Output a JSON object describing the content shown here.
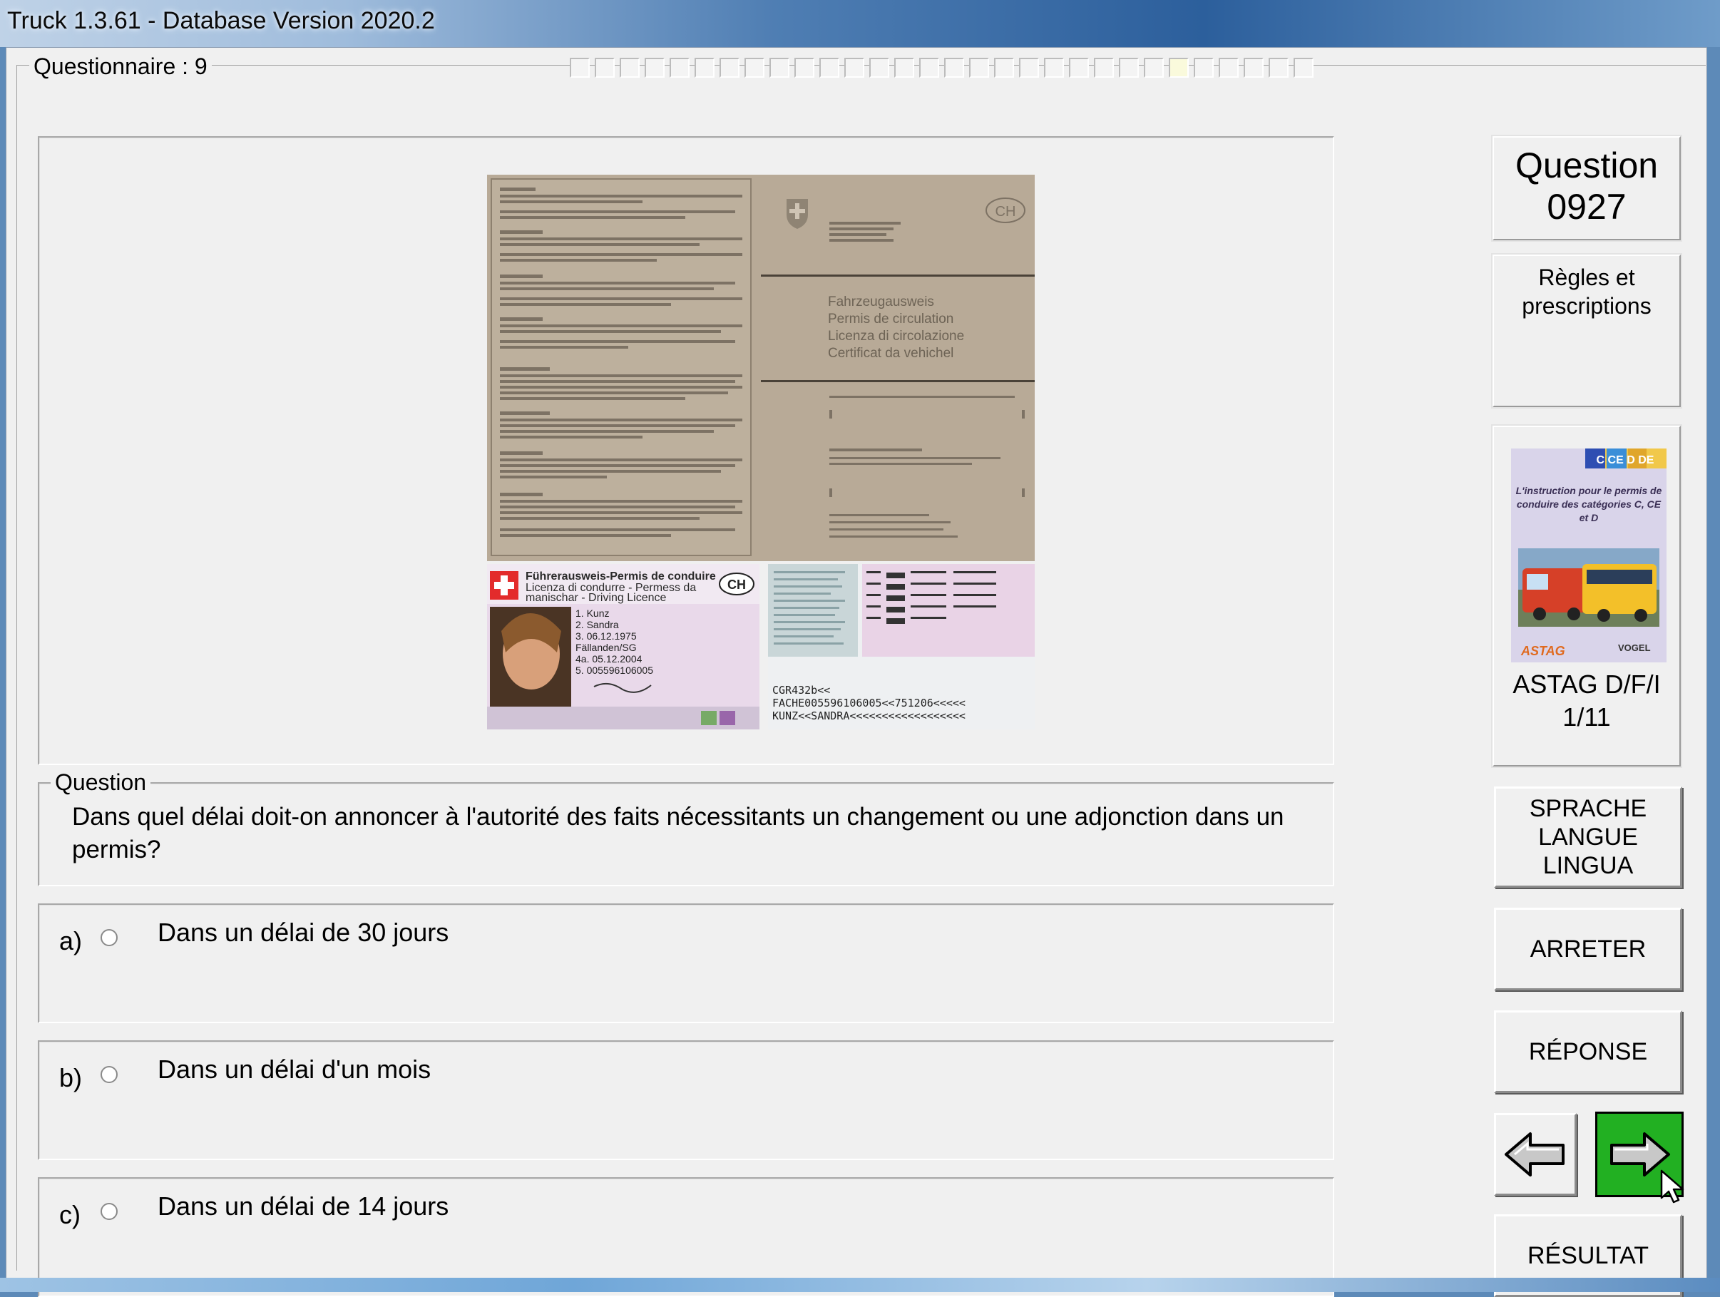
{
  "window": {
    "title": "Truck 1.3.61 - Database Version 2020.2"
  },
  "questionnaire": {
    "label": "Questionnaire : 9",
    "progress_total": 30,
    "progress_current": 25
  },
  "image": {
    "cert_lines": [
      "Fahrzeugausweis",
      "Permis de circulation",
      "Licenza di circolazione",
      "Certificat da vehichel"
    ],
    "cert_ch": "CH",
    "license_header": "Führerausweis-Permis de conduire",
    "license_header2": "Licenza di condurre - Permess da",
    "license_header3": "manischar - Driving Licence",
    "license_ch": "CH",
    "license_fields": [
      "1. Kunz",
      "2. Sandra",
      "3. 06.12.1975",
      "Fällanden/SG",
      "4a. 05.12.2004",
      "5. 005596106005"
    ],
    "mrz_lines": [
      "CGR432b<<",
      "FACHE005596106005<<751206<<<<<",
      "KUNZ<<SANDRA<<<<<<<<<<<<<<<<<<"
    ]
  },
  "question": {
    "label": "Question",
    "text": "Dans quel délai doit-on annoncer à l'autorité des faits nécessitants un changement ou une adjonction dans un permis?"
  },
  "answers": [
    {
      "letter": "a)",
      "text": "Dans un délai de 30 jours"
    },
    {
      "letter": "b)",
      "text": "Dans un délai d'un mois"
    },
    {
      "letter": "c)",
      "text": "Dans un délai de 14 jours"
    }
  ],
  "sidebar": {
    "question_label": "Question",
    "question_number": "0927",
    "category_line1": "Règles et",
    "category_line2": "prescriptions",
    "book": {
      "badge": "C CE D DE",
      "cover_text": "L'instruction pour le permis de conduire des catégories C, CE et D",
      "publisher": "VOGEL",
      "caption_line1": "ASTAG D/F/I",
      "caption_line2": "1/11"
    },
    "language_line1": "SPRACHE",
    "language_line2": "LANGUE",
    "language_line3": "LINGUA",
    "stop_label": "ARRETER",
    "answer_label": "RÉPONSE",
    "result_label": "RÉSULTAT",
    "prev_icon": "arrow-left-icon",
    "next_icon": "arrow-right-icon",
    "next_color": "#22b022"
  }
}
